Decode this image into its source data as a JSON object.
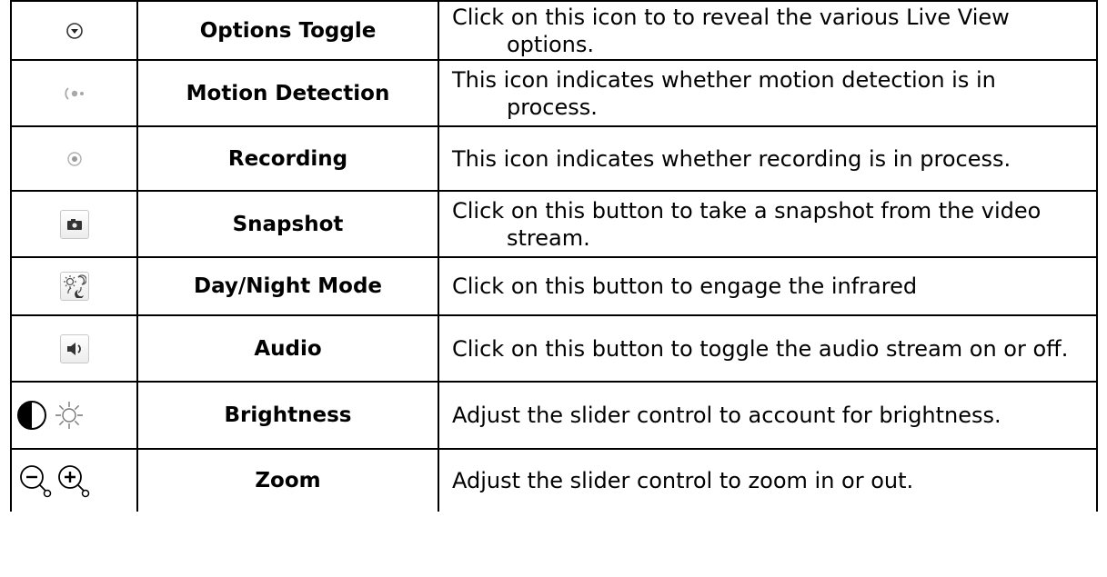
{
  "rows": [
    {
      "icon": "chevron-down-circle-icon",
      "name": "Options Toggle",
      "desc": "Click on this icon to to reveal the various Live View options."
    },
    {
      "icon": "motion-waves-icon",
      "name": "Motion Detection",
      "desc": "This icon indicates whether motion detection is in process."
    },
    {
      "icon": "record-dot-icon",
      "name": "Recording",
      "desc": "This icon indicates whether recording is in process."
    },
    {
      "icon": "camera-icon",
      "name": "Snapshot",
      "desc": "Click on this button to take a snapshot from the video stream."
    },
    {
      "icon": "day-night-icon",
      "name": "Day/Night Mode",
      "desc": "Click on this button to engage the infrared"
    },
    {
      "icon": "speaker-icon",
      "name": "Audio",
      "desc": "Click on this button to toggle the audio stream on or off."
    },
    {
      "icon": "contrast-sun-icon",
      "name": "Brightness",
      "desc": "Adjust the slider control to account for brightness."
    },
    {
      "icon": "zoom-in-out-icon",
      "name": "Zoom",
      "desc": "Adjust the slider control to zoom in or out."
    }
  ],
  "colors": {
    "border": "#000000",
    "icon_gray": "#9a9a9a"
  }
}
